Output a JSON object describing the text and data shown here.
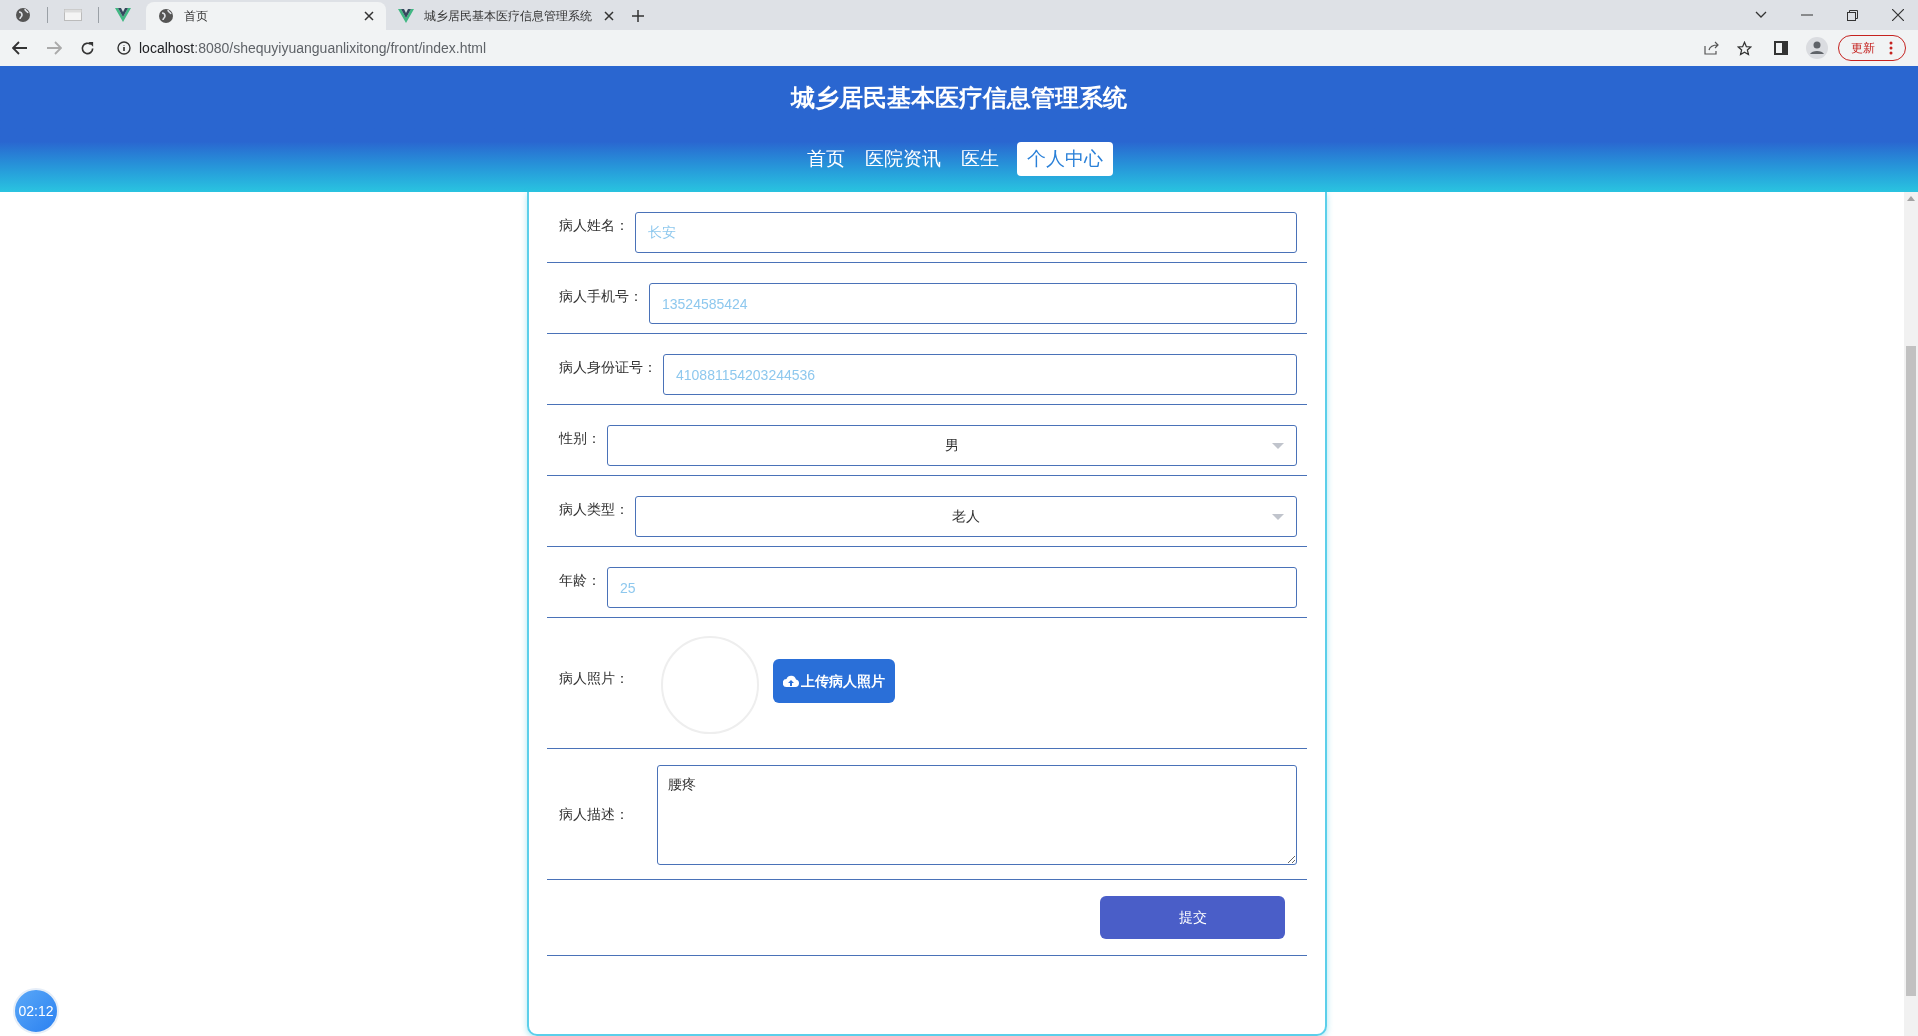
{
  "browser": {
    "tabs": [
      {
        "title": "首页",
        "selected": true
      },
      {
        "title": "城乡居民基本医疗信息管理系统",
        "selected": false
      }
    ],
    "address": {
      "host": "localhost",
      "rest": ":8080/shequyiyuanguanlixitong/front/index.html"
    },
    "update_button": "更新"
  },
  "header": {
    "title": "城乡居民基本医疗信息管理系统",
    "nav": [
      {
        "label": "首页",
        "selected": false
      },
      {
        "label": "医院资讯",
        "selected": false
      },
      {
        "label": "医生",
        "selected": false
      },
      {
        "label": "个人中心",
        "selected": true
      }
    ]
  },
  "form": {
    "fields": [
      {
        "kind": "text",
        "label": "病人姓名：",
        "value": "长安"
      },
      {
        "kind": "text",
        "label": "病人手机号：",
        "value": "13524585424"
      },
      {
        "kind": "text",
        "label": "病人身份证号：",
        "value": "410881154203244536"
      },
      {
        "kind": "select",
        "label": "性别：",
        "value": "男"
      },
      {
        "kind": "select",
        "label": "病人类型：",
        "value": "老人"
      },
      {
        "kind": "text",
        "label": "年龄：",
        "value": "25"
      },
      {
        "kind": "upload",
        "label": "病人照片：",
        "button": "上传病人照片"
      },
      {
        "kind": "textarea",
        "label": "病人描述：",
        "value": "腰疼"
      }
    ],
    "submit": "提交"
  },
  "timer": "02:12"
}
